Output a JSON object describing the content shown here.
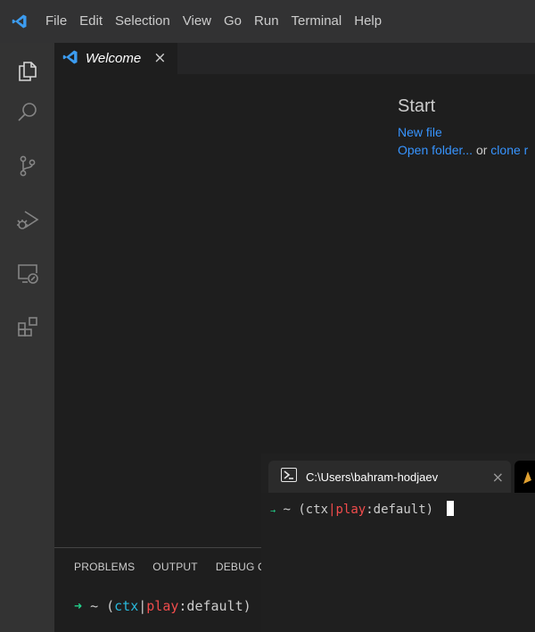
{
  "menu": {
    "items": [
      "File",
      "Edit",
      "Selection",
      "View",
      "Go",
      "Run",
      "Terminal",
      "Help"
    ]
  },
  "editor_tab": {
    "label": "Welcome",
    "close": "×"
  },
  "welcome": {
    "start_title": "Start",
    "new_file": "New file",
    "open_folder": "Open folder...",
    "or_text": "or",
    "clone": "clone r"
  },
  "panel": {
    "tabs": [
      "PROBLEMS",
      "OUTPUT",
      "DEBUG CO"
    ],
    "prompt": {
      "arrow": "➜",
      "tilde": "~",
      "open_paren": "(",
      "ctx": "ctx",
      "sep": "|",
      "play": "play",
      "colon_default": ":default",
      "close_paren": ")"
    }
  },
  "windows_terminal": {
    "tab_label": "C:\\Users\\bahram-hodjaev",
    "tab_close": "×",
    "prompt": {
      "arrow": "→",
      "tilde": "~",
      "text_a": "(ctx",
      "sep": "|",
      "play": "play",
      "text_b": ":default)"
    }
  },
  "colors": {
    "link": "#3794ff",
    "prompt_green": "#23d18b",
    "prompt_cyan": "#29b8db",
    "prompt_red": "#f14c4c",
    "vscode_blue": "#3c9cf0"
  },
  "icons": {
    "app_logo": "vscode-logo-icon",
    "activity": [
      "explorer-icon",
      "search-icon",
      "source-control-icon",
      "run-debug-icon",
      "remote-explorer-icon",
      "extensions-icon"
    ],
    "terminal_tab": "powershell-icon"
  }
}
